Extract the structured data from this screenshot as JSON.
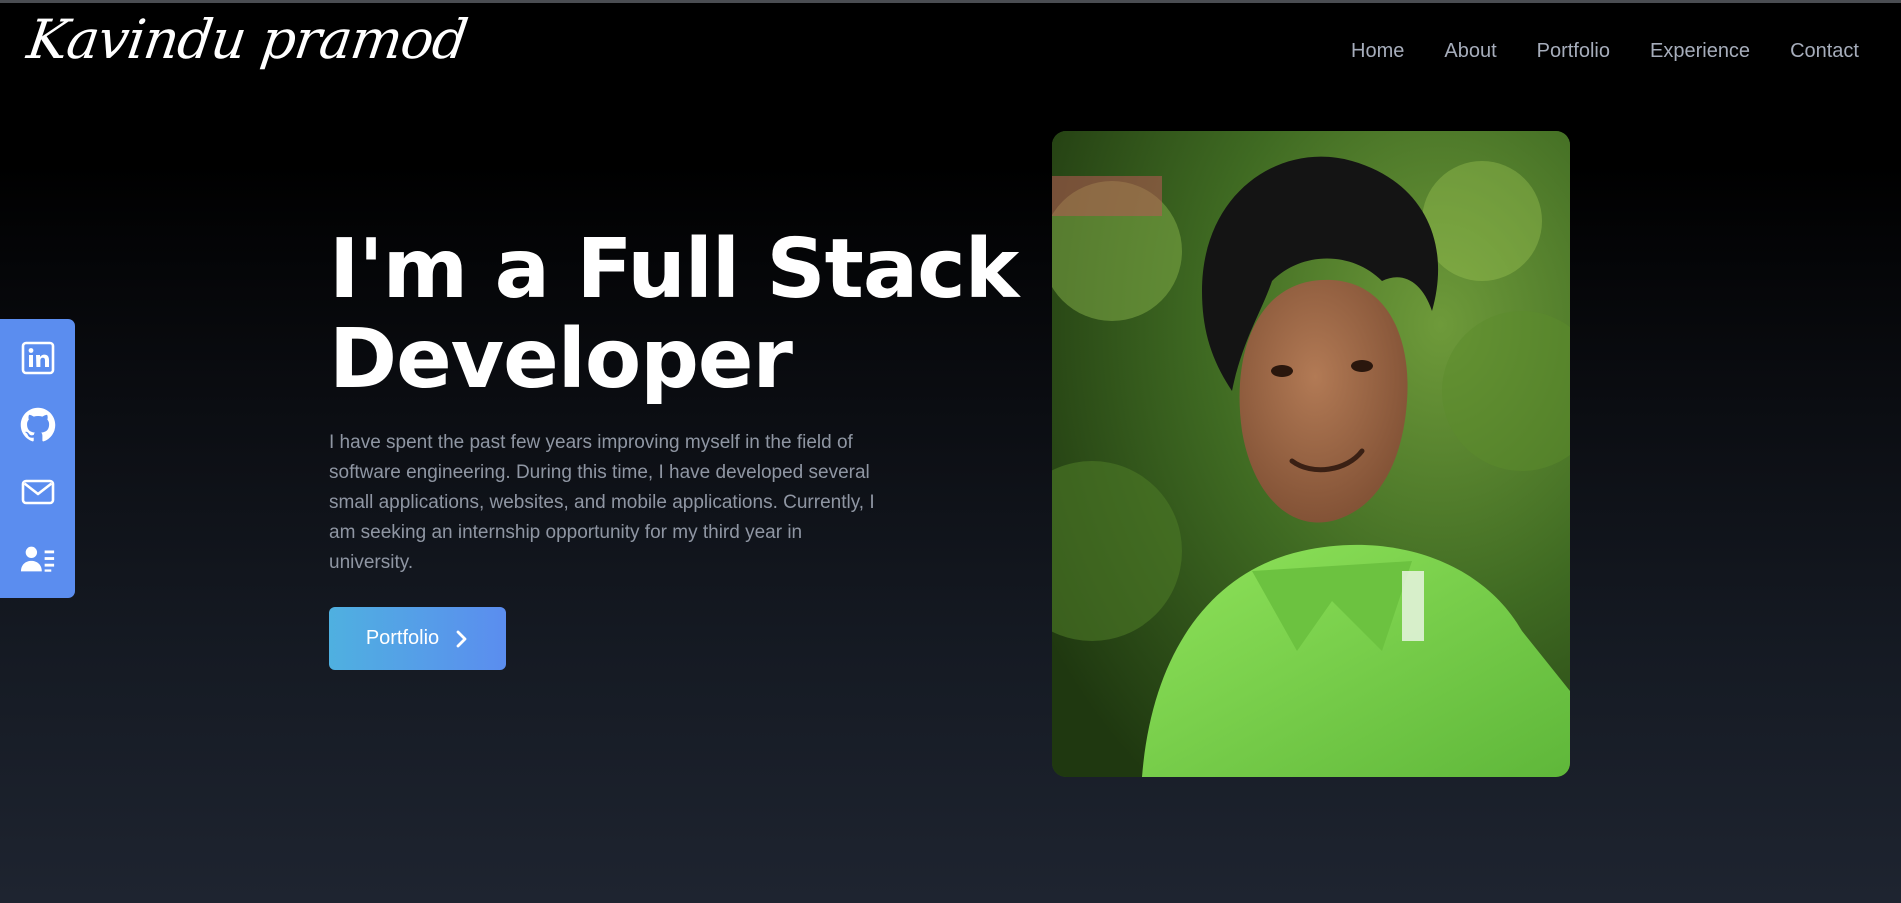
{
  "header": {
    "logo_text": "Kavindu pramod",
    "nav": [
      {
        "label": "Home"
      },
      {
        "label": "About"
      },
      {
        "label": "Portfolio"
      },
      {
        "label": "Experience"
      },
      {
        "label": "Contact"
      }
    ]
  },
  "social": {
    "items": [
      {
        "icon": "linkedin-icon"
      },
      {
        "icon": "github-icon"
      },
      {
        "icon": "mail-icon"
      },
      {
        "icon": "contact-card-icon"
      }
    ],
    "background_color": "#5b8def"
  },
  "hero": {
    "title": "I'm a Full Stack Developer",
    "description": "I have spent the past few years improving myself in the field of software engineering. During this time, I have developed several small applications, websites, and mobile applications. Currently, I am seeking an internship opportunity for my third year in university.",
    "button_label": "Portfolio",
    "button_icon": "chevron-right-icon",
    "photo_icon": "profile-photo"
  },
  "colors": {
    "accent": "#5b8def",
    "accent_gradient_start": "#4fb0e0",
    "nav_text": "#a6adbb",
    "body_text": "#8f96a3",
    "photo_shirt": "#7ed64a"
  }
}
